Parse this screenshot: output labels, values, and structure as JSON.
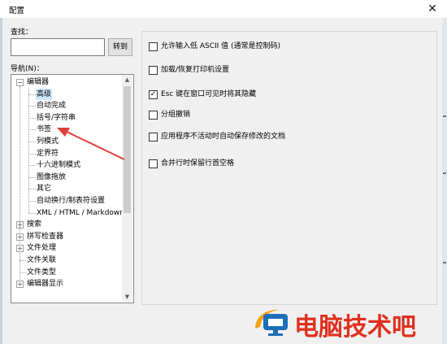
{
  "window": {
    "title": "配置",
    "close_glyph": "✕"
  },
  "search": {
    "label": "查找：",
    "value": "",
    "goto_label": "转到"
  },
  "nav": {
    "label": "导航(N)：",
    "tree": [
      {
        "label": "编辑器",
        "level": 0,
        "expander": "−"
      },
      {
        "label": "高级",
        "level": 1,
        "selected": true
      },
      {
        "label": "自动完成",
        "level": 1
      },
      {
        "label": "括号/字符串",
        "level": 1
      },
      {
        "label": "书签",
        "level": 1
      },
      {
        "label": "列模式",
        "level": 1
      },
      {
        "label": "定界符",
        "level": 1
      },
      {
        "label": "十六进制模式",
        "level": 1
      },
      {
        "label": "图像拖放",
        "level": 1
      },
      {
        "label": "其它",
        "level": 1
      },
      {
        "label": "自动换行/制表符设置",
        "level": 1
      },
      {
        "label": "XML / HTML / Markdown",
        "level": 1
      },
      {
        "label": "搜索",
        "level": 0,
        "expander": "+"
      },
      {
        "label": "拼写检查器",
        "level": 0,
        "expander": "+"
      },
      {
        "label": "文件处理",
        "level": 0,
        "expander": "+"
      },
      {
        "label": "文件关联",
        "level": 0
      },
      {
        "label": "文件类型",
        "level": 0
      },
      {
        "label": "编辑器显示",
        "level": 0,
        "expander": "+"
      }
    ],
    "scroll_up": "▲",
    "scroll_down": "▼"
  },
  "options": [
    {
      "label": "允许输入低 ASCII 值 (通常是控制码)",
      "checked": false
    },
    {
      "label": "加载/恢复打印机设置",
      "checked": false
    },
    {
      "label": "Esc 键在窗口可见时将其隐藏",
      "checked": true
    },
    {
      "label": "分组撤销",
      "checked": false
    },
    {
      "label": "应用程序不活动时自动保存修改的文档",
      "checked": false
    },
    {
      "label": "合并行时保留行首空格",
      "checked": false
    }
  ],
  "check_glyph": "✓",
  "watermark": {
    "text": "电脑技术吧",
    "small": "f"
  },
  "colors": {
    "selection": "#cce8ff",
    "arrow": "#e0403a",
    "watermark": "#e0301e"
  }
}
